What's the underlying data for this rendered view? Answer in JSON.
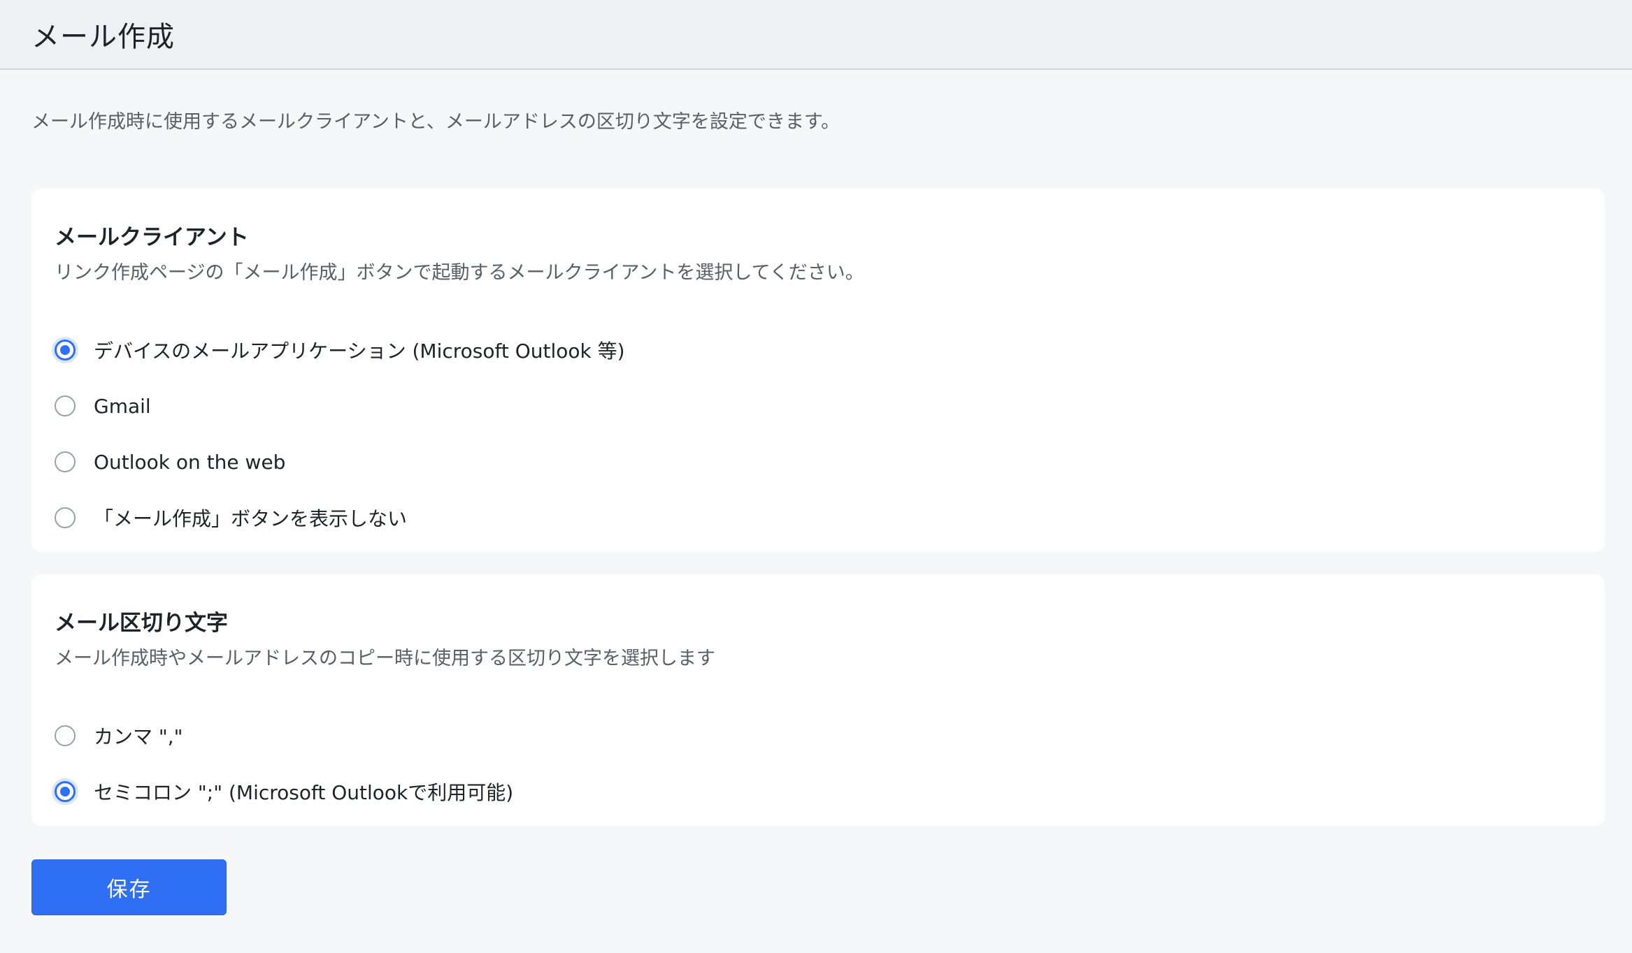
{
  "header": {
    "title": "メール作成"
  },
  "description": "メール作成時に使用するメールクライアントと、メールアドレスの区切り文字を設定できます。",
  "mail_client": {
    "title": "メールクライアント",
    "subtitle": "リンク作成ページの「メール作成」ボタンで起動するメールクライアントを選択してください。",
    "options": [
      {
        "label": "デバイスのメールアプリケーション (Microsoft Outlook 等)",
        "checked": true
      },
      {
        "label": "Gmail",
        "checked": false
      },
      {
        "label": "Outlook on the web",
        "checked": false
      },
      {
        "label": "「メール作成」ボタンを表示しない",
        "checked": false
      }
    ]
  },
  "separator": {
    "title": "メール区切り文字",
    "subtitle": "メール作成時やメールアドレスのコピー時に使用する区切り文字を選択します",
    "options": [
      {
        "label": "カンマ \",\"",
        "checked": false
      },
      {
        "label": "セミコロン \";\" (Microsoft Outlookで利用可能)",
        "checked": true
      }
    ]
  },
  "save_button": {
    "label": "保存"
  },
  "colors": {
    "accent": "#2f6ff3",
    "background": "#f6f7f9",
    "card": "#ffffff"
  }
}
